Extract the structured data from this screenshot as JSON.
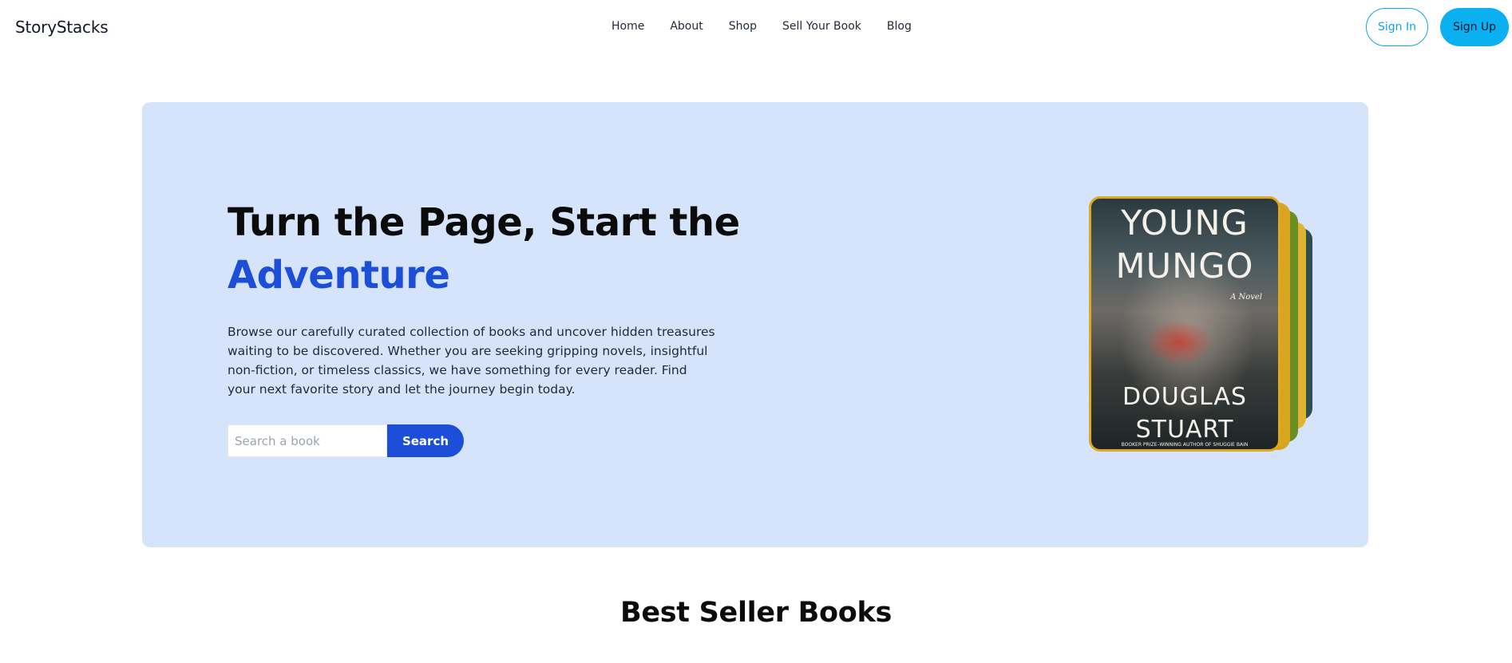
{
  "header": {
    "brand": "StoryStacks",
    "nav": [
      "Home",
      "About",
      "Shop",
      "Sell Your Book",
      "Blog"
    ],
    "sign_in_label": "Sign In",
    "sign_up_label": "Sign Up"
  },
  "hero": {
    "title_line1": "Turn the Page, Start the",
    "title_accent": "Adventure",
    "description": "Browse our carefully curated collection of books and uncover hidden treasures waiting to be discovered. Whether you are seeking gripping novels, insightful non-fiction, or timeless classics, we have something for every reader. Find your next favorite story and let the journey begin today.",
    "search_placeholder": "Search a book",
    "search_value": "",
    "search_button": "Search",
    "featured_book": {
      "title": "YOUNG MUNGO",
      "subtitle": "A Novel",
      "author": "DOUGLAS STUART",
      "tagline": "BOOKER PRIZE–WINNING AUTHOR OF SHUGGIE BAIN"
    }
  },
  "sections": {
    "best_sellers_title": "Best Seller Books"
  },
  "colors": {
    "accent": "#1d4ed8",
    "sign_up_bg": "#0ab0f0",
    "sign_in_border": "#0ea5e9",
    "hero_bg": "#d6e4fb"
  }
}
